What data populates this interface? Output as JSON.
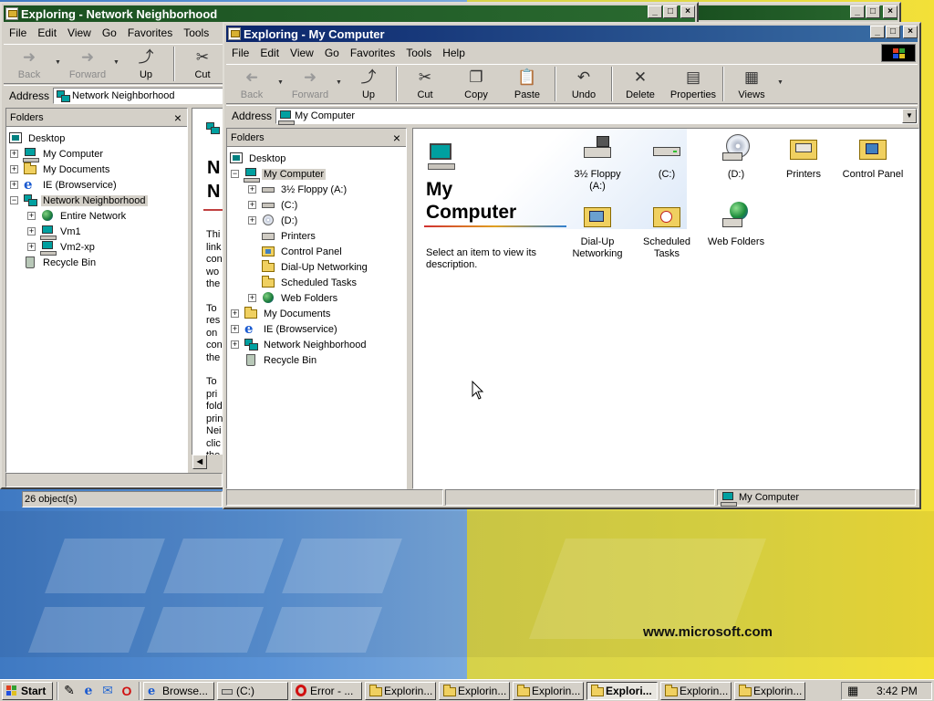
{
  "desktop": {
    "watermark": "www.microsoft.com"
  },
  "back_window": {
    "title": "Exploring - Network Neighborhood",
    "menu": [
      "File",
      "Edit",
      "View",
      "Go",
      "Favorites",
      "Tools"
    ],
    "toolbar": {
      "back": "Back",
      "forward": "Forward",
      "up": "Up",
      "cut": "Cut"
    },
    "address_label": "Address",
    "address_value": "Network Neighborhood",
    "folders_label": "Folders",
    "tree": [
      {
        "label": "Desktop",
        "icon": "desktop-icon"
      },
      {
        "label": "My Computer",
        "icon": "computer-icon"
      },
      {
        "label": "My Documents",
        "icon": "folder-icon"
      },
      {
        "label": "IE (Browservice)",
        "icon": "ie-icon"
      },
      {
        "label": "Network Neighborhood",
        "icon": "network-icon"
      },
      {
        "label": "Entire Network",
        "icon": "globe-icon"
      },
      {
        "label": "Vm1",
        "icon": "computer-icon"
      },
      {
        "label": "Vm2-xp",
        "icon": "computer-icon"
      },
      {
        "label": "Recycle Bin",
        "icon": "recycle-bin-icon"
      }
    ],
    "content_heading_part": "N",
    "content_text_lines": [
      "Thi",
      "link",
      "con",
      "wo",
      "the",
      "To",
      "res",
      "on",
      "con",
      "the",
      "To",
      "pri",
      "fold",
      "prin",
      "Nei",
      "clic",
      "the"
    ],
    "status": "26 object(s)"
  },
  "front_window": {
    "title": "Exploring - My Computer",
    "menu": [
      "File",
      "Edit",
      "View",
      "Go",
      "Favorites",
      "Tools",
      "Help"
    ],
    "toolbar": {
      "back": "Back",
      "forward": "Forward",
      "up": "Up",
      "cut": "Cut",
      "copy": "Copy",
      "paste": "Paste",
      "undo": "Undo",
      "delete": "Delete",
      "properties": "Properties",
      "views": "Views"
    },
    "address_label": "Address",
    "address_value": "My Computer",
    "folders_label": "Folders",
    "tree": [
      {
        "label": "Desktop"
      },
      {
        "label": "My Computer"
      },
      {
        "label": "3½ Floppy (A:)"
      },
      {
        "label": "(C:)"
      },
      {
        "label": "(D:)"
      },
      {
        "label": "Printers"
      },
      {
        "label": "Control Panel"
      },
      {
        "label": "Dial-Up Networking"
      },
      {
        "label": "Scheduled Tasks"
      },
      {
        "label": "Web Folders"
      },
      {
        "label": "My Documents"
      },
      {
        "label": "IE (Browservice)"
      },
      {
        "label": "Network Neighborhood"
      },
      {
        "label": "Recycle Bin"
      }
    ],
    "panel_title_line1": "My",
    "panel_title_line2": "Computer",
    "panel_desc": "Select an item to view its description.",
    "items": [
      {
        "label1": "3½ Floppy",
        "label2": "(A:)",
        "icon": "floppy-drive-icon"
      },
      {
        "label1": "(C:)",
        "label2": "",
        "icon": "hard-drive-icon"
      },
      {
        "label1": "(D:)",
        "label2": "",
        "icon": "cd-drive-icon"
      },
      {
        "label1": "Printers",
        "label2": "",
        "icon": "printers-folder-icon"
      },
      {
        "label1": "Control Panel",
        "label2": "",
        "icon": "control-panel-icon"
      },
      {
        "label1": "Dial-Up",
        "label2": "Networking",
        "icon": "dialup-networking-icon"
      },
      {
        "label1": "Scheduled",
        "label2": "Tasks",
        "icon": "scheduled-tasks-icon"
      },
      {
        "label1": "Web Folders",
        "label2": "",
        "icon": "web-folders-icon"
      }
    ],
    "status_right": "My Computer"
  },
  "taskbar": {
    "start": "Start",
    "buttons": [
      "Browse...",
      "(C:)",
      "Error - ...",
      "Explorin...",
      "Explorin...",
      "Explorin...",
      "Explori...",
      "Explorin...",
      "Explorin..."
    ],
    "clock": "3:42 PM"
  }
}
